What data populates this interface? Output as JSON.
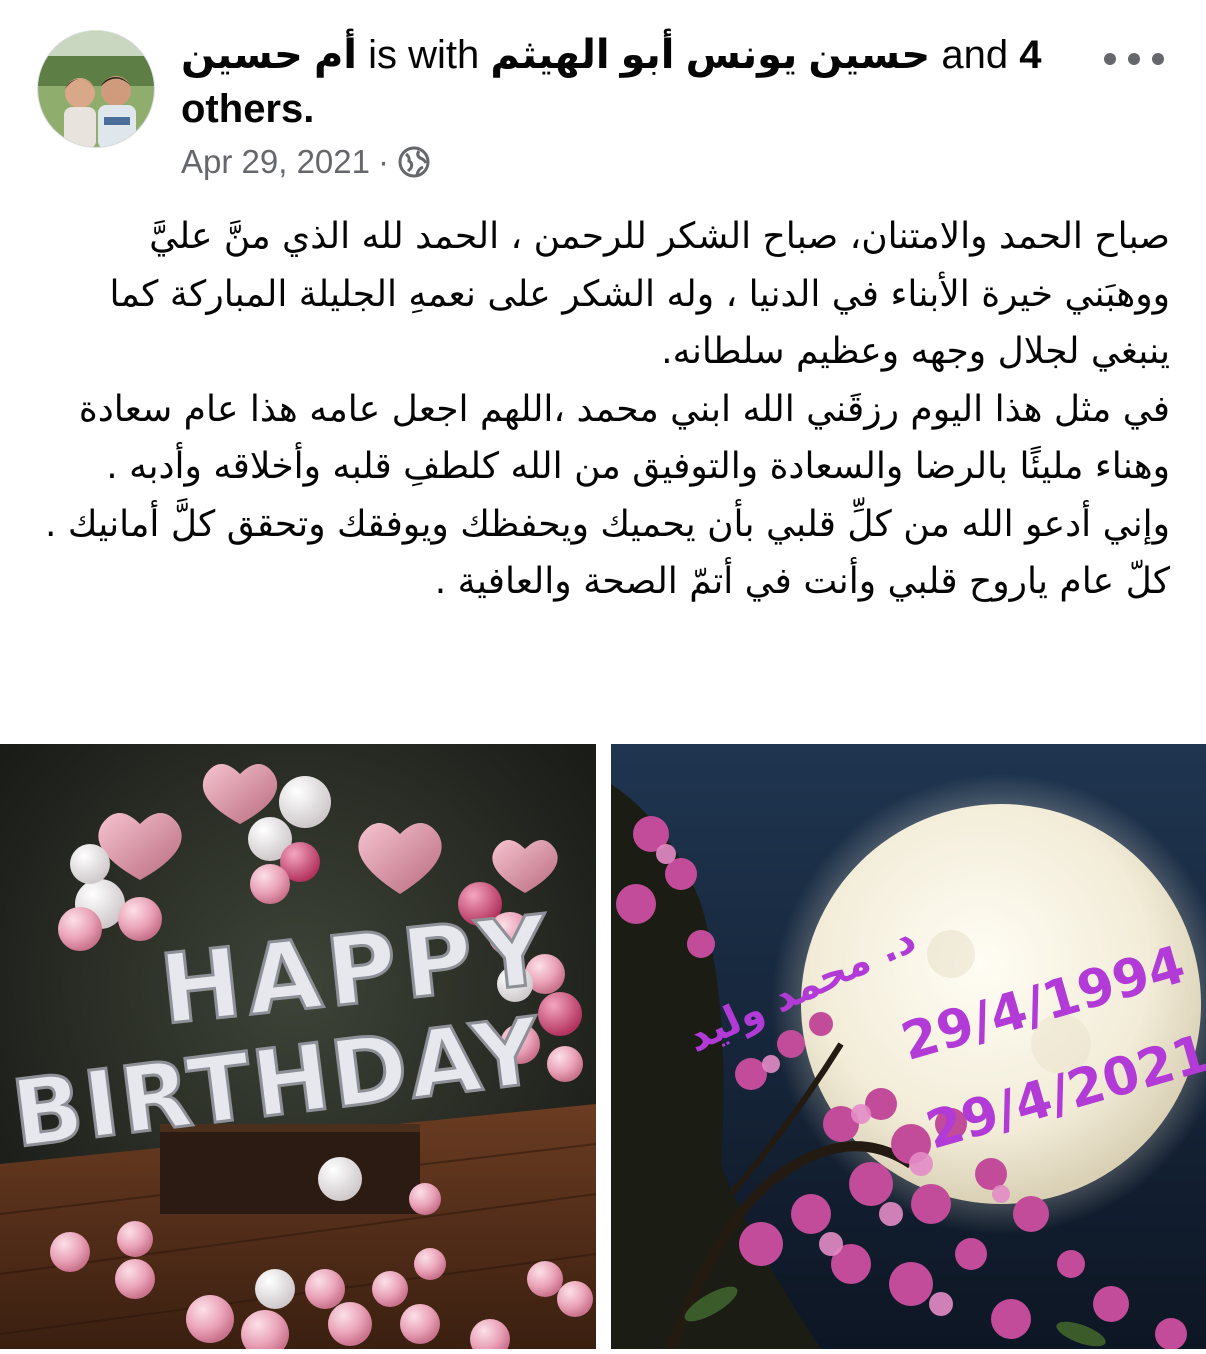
{
  "header": {
    "author": "أم حسين",
    "with_text": "is with",
    "tagged_person": "حسين يونس أبو الهيثم",
    "and_text": "and",
    "others_count": "4",
    "others_text": "others.",
    "date": "Apr 29, 2021",
    "separator": "·",
    "privacy_icon": "globe-icon",
    "more_icon": "more-options-icon"
  },
  "post": {
    "paragraphs": [
      "صباح الحمد والامتنان، صباح الشكر للرحمن ، الحمد لله الذي منَّ عليَّ ووهبَني خيرة الأبناء في الدنيا ، وله الشكر على نعمهِ الجليلة المباركة كما ينبغي لجلال وجهه وعظيم سلطانه.",
      "في مثل هذا اليوم رزقَني الله ابني محمد ،اللهم اجعل عامه هذا عام سعادة وهناء مليئًا بالرضا والسعادة والتوفيق من الله كلطفِ قلبه وأخلاقه وأدبه .",
      "وإني أدعو الله من كلِّ قلبي بأن يحميك ويحفظك ويوفقك وتحقق كلَّ أمانيك .",
      "كلّ عام ياروح قلبي وأنت في أتمّ الصحة والعافية ."
    ]
  },
  "photos": {
    "left": {
      "balloon_word_1": "HAPPY",
      "balloon_word_2": "BIRTHDAY"
    },
    "right": {
      "name": "د. محمد وليد",
      "date_1": "29/4/1994",
      "date_2": "29/4/2021"
    }
  },
  "colors": {
    "text": "#050505",
    "secondary": "#65676b",
    "overlay_text": "#b23ad6"
  }
}
